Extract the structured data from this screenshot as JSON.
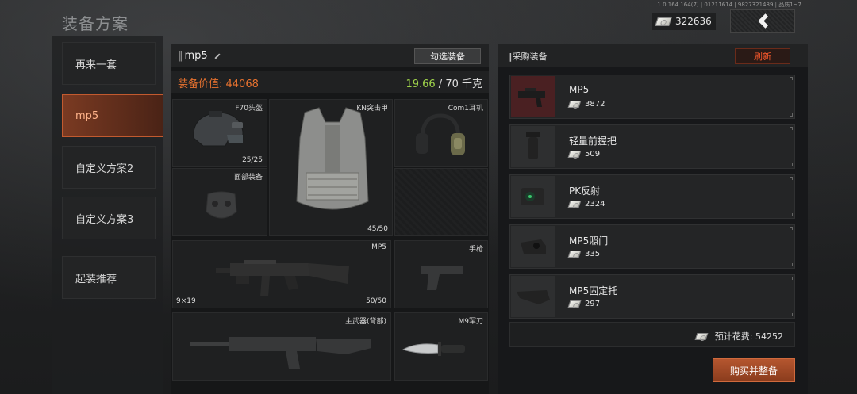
{
  "version": "1.0.164.164(7) | 01211614 | 9827321489 | 品质1~7",
  "page_title": "装备方案",
  "currency": {
    "amount": "322636",
    "icon": "cash-icon"
  },
  "presets": [
    {
      "label": "再来一套"
    },
    {
      "label": "mp5"
    },
    {
      "label": "自定义方案2"
    },
    {
      "label": "自定义方案3"
    },
    {
      "label": "起装推荐"
    }
  ],
  "loadout": {
    "name": "mp5",
    "select_button": "勾选装备",
    "value_label": "装备价值: 44068",
    "weight_current": "19.66",
    "weight_max": " / 70 千克",
    "slots": {
      "helmet": {
        "label": "F70头盔",
        "durability": "25/25"
      },
      "armor": {
        "label": "KN突击甲",
        "durability": "45/50"
      },
      "headset": {
        "label": "Com1耳机"
      },
      "face": {
        "label": "面部装备"
      },
      "primary": {
        "label": "MP5",
        "ammo": "9×19",
        "durability": "50/50"
      },
      "pistol": {
        "label": "手枪"
      },
      "back_weapon": {
        "label": "主武器(背部)"
      },
      "knife": {
        "label": "M9军刀"
      }
    }
  },
  "shop": {
    "title": "采购装备",
    "refresh_label": "刷新",
    "items": [
      {
        "name": "MP5",
        "price": "3872"
      },
      {
        "name": "轻量前握把",
        "price": "509"
      },
      {
        "name": "PK反射",
        "price": "2324"
      },
      {
        "name": "MP5照门",
        "price": "335"
      },
      {
        "name": "MP5固定托",
        "price": "297"
      }
    ],
    "estimate": "预计花费: 54252",
    "buy_label": "购买并整备"
  },
  "colors": {
    "accent": "#e8722f",
    "weight_ok": "#9ed24a",
    "refresh": "#ff5a2c",
    "buy": "#b5562f"
  }
}
